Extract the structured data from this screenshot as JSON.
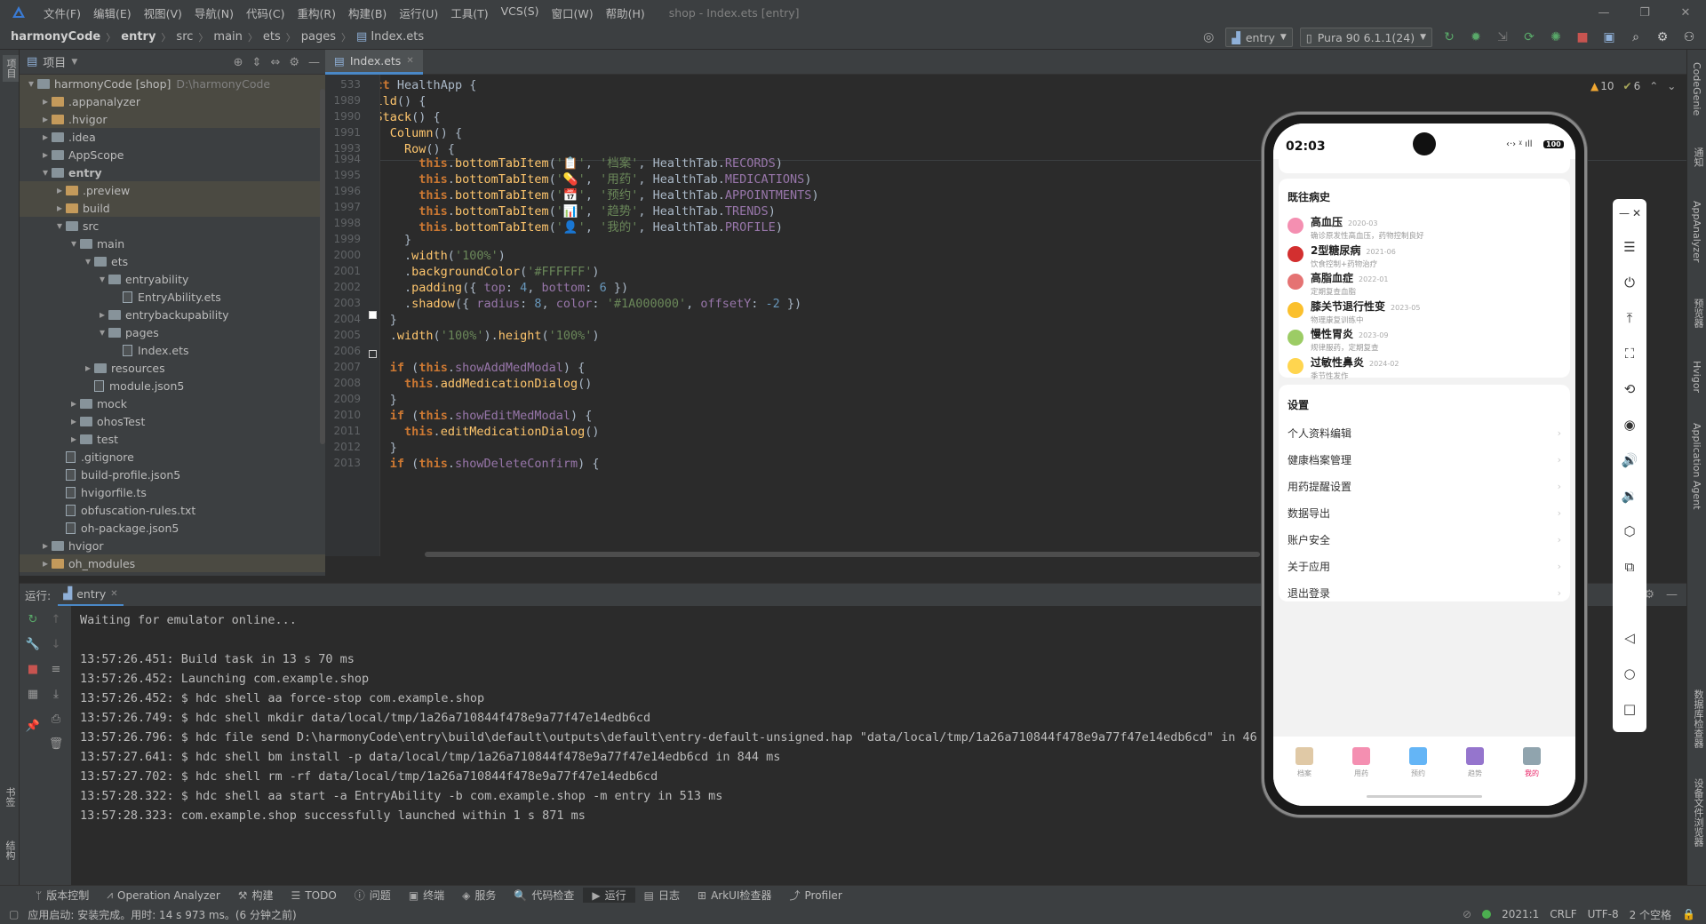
{
  "menubar": {
    "items": [
      "文件(F)",
      "编辑(E)",
      "视图(V)",
      "导航(N)",
      "代码(C)",
      "重构(R)",
      "构建(B)",
      "运行(U)",
      "工具(T)",
      "VCS(S)",
      "窗口(W)",
      "帮助(H)"
    ],
    "title": "shop - Index.ets [entry]"
  },
  "breadcrumb": [
    "harmonyCode",
    "entry",
    "src",
    "main",
    "ets",
    "pages",
    "Index.ets"
  ],
  "toolbar": {
    "run_config": "entry",
    "device": "Pura 90 6.1.1(24)"
  },
  "project_panel": {
    "title": "项目",
    "tree": [
      {
        "label": "harmonyCode [shop]",
        "path": "D:\\harmonyCode",
        "depth": 0,
        "type": "folder",
        "open": true,
        "hl": true
      },
      {
        "label": ".appanalyzer",
        "depth": 1,
        "type": "folder-orange",
        "open": false,
        "hl": true
      },
      {
        "label": ".hvigor",
        "depth": 1,
        "type": "folder-orange",
        "open": false,
        "hl": true
      },
      {
        "label": ".idea",
        "depth": 1,
        "type": "folder",
        "open": false
      },
      {
        "label": "AppScope",
        "depth": 1,
        "type": "folder",
        "open": false
      },
      {
        "label": "entry",
        "depth": 1,
        "type": "folder",
        "open": true,
        "bold": true
      },
      {
        "label": ".preview",
        "depth": 2,
        "type": "folder-orange",
        "open": false,
        "hl": true
      },
      {
        "label": "build",
        "depth": 2,
        "type": "folder-orange",
        "open": false,
        "hl": true
      },
      {
        "label": "src",
        "depth": 2,
        "type": "folder",
        "open": true
      },
      {
        "label": "main",
        "depth": 3,
        "type": "folder",
        "open": true
      },
      {
        "label": "ets",
        "depth": 4,
        "type": "folder",
        "open": true
      },
      {
        "label": "entryability",
        "depth": 5,
        "type": "folder",
        "open": true
      },
      {
        "label": "EntryAbility.ets",
        "depth": 6,
        "type": "file"
      },
      {
        "label": "entrybackupability",
        "depth": 5,
        "type": "folder",
        "open": false
      },
      {
        "label": "pages",
        "depth": 5,
        "type": "folder",
        "open": true
      },
      {
        "label": "Index.ets",
        "depth": 6,
        "type": "file"
      },
      {
        "label": "resources",
        "depth": 4,
        "type": "folder",
        "open": false
      },
      {
        "label": "module.json5",
        "depth": 4,
        "type": "file"
      },
      {
        "label": "mock",
        "depth": 3,
        "type": "folder",
        "open": false
      },
      {
        "label": "ohosTest",
        "depth": 3,
        "type": "folder",
        "open": false
      },
      {
        "label": "test",
        "depth": 3,
        "type": "folder",
        "open": false
      },
      {
        "label": ".gitignore",
        "depth": 2,
        "type": "file"
      },
      {
        "label": "build-profile.json5",
        "depth": 2,
        "type": "file"
      },
      {
        "label": "hvigorfile.ts",
        "depth": 2,
        "type": "file"
      },
      {
        "label": "obfuscation-rules.txt",
        "depth": 2,
        "type": "file"
      },
      {
        "label": "oh-package.json5",
        "depth": 2,
        "type": "file"
      },
      {
        "label": "hvigor",
        "depth": 1,
        "type": "folder",
        "open": false
      },
      {
        "label": "oh_modules",
        "depth": 1,
        "type": "folder-orange",
        "open": false,
        "hl": true
      }
    ]
  },
  "editor": {
    "tab": "Index.ets",
    "inspections": {
      "warnings": "10",
      "weak": "6"
    },
    "sticky": [
      {
        "ln": "533",
        "html": "<span class='kw'>struct</span> <span class='ty'>HealthApp</span> {"
      },
      {
        "ln": "1989",
        "html": "  <span class='fn'>build</span>() {"
      },
      {
        "ln": "1990",
        "html": "    <span class='fn'>Stack</span>() {"
      },
      {
        "ln": "1991",
        "html": "      <span class='fn'>Column</span>() {"
      },
      {
        "ln": "1993",
        "html": "        <span class='fn'>Row</span>() {"
      }
    ],
    "lines": [
      {
        "ln": "1994",
        "html": "          <span class='this'>this</span>.<span class='fn'>bottomTabItem</span>(<span class='str'>'📋'</span>, <span class='str'>'档案'</span>, HealthTab.<span class='pr'>RECORDS</span>)"
      },
      {
        "ln": "1995",
        "html": "          <span class='this'>this</span>.<span class='fn'>bottomTabItem</span>(<span class='str'>'💊'</span>, <span class='str'>'用药'</span>, HealthTab.<span class='pr'>MEDICATIONS</span>)"
      },
      {
        "ln": "1996",
        "html": "          <span class='this'>this</span>.<span class='fn'>bottomTabItem</span>(<span class='str'>'📅'</span>, <span class='str'>'预约'</span>, HealthTab.<span class='pr'>APPOINTMENTS</span>)"
      },
      {
        "ln": "1997",
        "html": "          <span class='this'>this</span>.<span class='fn'>bottomTabItem</span>(<span class='str'>'📊'</span>, <span class='str'>'趋势'</span>, HealthTab.<span class='pr'>TRENDS</span>)"
      },
      {
        "ln": "1998",
        "html": "          <span class='this'>this</span>.<span class='fn'>bottomTabItem</span>(<span class='str'>'👤'</span>, <span class='str'>'我的'</span>, HealthTab.<span class='pr'>PROFILE</span>)"
      },
      {
        "ln": "1999",
        "html": "        }"
      },
      {
        "ln": "2000",
        "html": "        .<span class='fn'>width</span>(<span class='str'>'100%'</span>)"
      },
      {
        "ln": "2001",
        "html": "        .<span class='fn'>backgroundColor</span>(<span class='str'>'#FFFFFF'</span>)"
      },
      {
        "ln": "2002",
        "html": "        .<span class='fn'>padding</span>({ <span class='pr'>top</span>: <span class='num'>4</span>, <span class='pr'>bottom</span>: <span class='num'>6</span> })"
      },
      {
        "ln": "2003",
        "html": "        .<span class='fn'>shadow</span>({ <span class='pr'>radius</span>: <span class='num'>8</span>, <span class='pr'>color</span>: <span class='str'>'#1A000000'</span>, <span class='pr'>offsetY</span>: <span class='num'>-2</span> })"
      },
      {
        "ln": "2004",
        "html": "      }"
      },
      {
        "ln": "2005",
        "html": "      .<span class='fn'>width</span>(<span class='str'>'100%'</span>).<span class='fn'>height</span>(<span class='str'>'100%'</span>)"
      },
      {
        "ln": "2006",
        "html": ""
      },
      {
        "ln": "2007",
        "html": "      <span class='kw'>if</span> (<span class='this'>this</span>.<span class='pr'>showAddMedModal</span>) {"
      },
      {
        "ln": "2008",
        "html": "        <span class='this'>this</span>.<span class='fn'>addMedicationDialog</span>()"
      },
      {
        "ln": "2009",
        "html": "      }"
      },
      {
        "ln": "2010",
        "html": "      <span class='kw'>if</span> (<span class='this'>this</span>.<span class='pr'>showEditMedModal</span>) {"
      },
      {
        "ln": "2011",
        "html": "        <span class='this'>this</span>.<span class='fn'>editMedicationDialog</span>()"
      },
      {
        "ln": "2012",
        "html": "      }"
      },
      {
        "ln": "2013",
        "html": "      <span class='kw'>if</span> (<span class='this'>this</span>.<span class='pr'>showDeleteConfirm</span>) {"
      }
    ]
  },
  "run_panel": {
    "label": "运行:",
    "tab": "entry",
    "console": [
      "Waiting for emulator online...",
      "",
      "13:57:26.451: Build task in 13 s 70 ms",
      "13:57:26.452: Launching com.example.shop",
      "13:57:26.452: $ hdc shell aa force-stop com.example.shop",
      "13:57:26.749: $ hdc shell mkdir data/local/tmp/1a26a710844f478e9a77f47e14edb6cd",
      "13:57:26.796: $ hdc file send D:\\harmonyCode\\entry\\build\\default\\outputs\\default\\entry-default-unsigned.hap \"data/local/tmp/1a26a710844f478e9a77f47e14edb6cd\" in 46 ms",
      "13:57:27.641: $ hdc shell bm install -p data/local/tmp/1a26a710844f478e9a77f47e14edb6cd in 844 ms",
      "13:57:27.702: $ hdc shell rm -rf data/local/tmp/1a26a710844f478e9a77f47e14edb6cd",
      "13:57:28.322: $ hdc shell aa start -a EntryAbility -b com.example.shop -m entry in 513 ms",
      "13:57:28.323: com.example.shop successfully launched within 1 s 871 ms"
    ]
  },
  "bottom_tools": [
    "版本控制",
    "Operation Analyzer",
    "构建",
    "TODO",
    "问题",
    "终端",
    "服务",
    "代码检查",
    "运行",
    "日志",
    "ArkUI检查器",
    "Profiler"
  ],
  "status": {
    "message": "应用启动: 安装完成。用时: 14 s 973 ms。(6 分钟之前)",
    "position": "2021:1",
    "line_sep": "CRLF",
    "encoding": "UTF-8",
    "indent": "2 个空格"
  },
  "left_strip": [
    "项目",
    "书签",
    "结构"
  ],
  "right_strip": [
    "CodeGenie",
    "通知",
    "AppAnalyzer",
    "预览器",
    "Hvigor",
    "Application Agent",
    "数据库检查器",
    "设备文件浏览器"
  ],
  "phone": {
    "time": "02:03",
    "battery": "100",
    "history_title": "既往病史",
    "history": [
      {
        "name": "高血压",
        "date": "2020-03",
        "desc": "确诊原发性高血压，药物控制良好",
        "color": "#f48fb1"
      },
      {
        "name": "2型糖尿病",
        "date": "2021-06",
        "desc": "饮食控制+药物治疗",
        "color": "#d32f2f"
      },
      {
        "name": "高脂血症",
        "date": "2022-01",
        "desc": "定期复查血脂",
        "color": "#e57373"
      },
      {
        "name": "膝关节退行性变",
        "date": "2023-05",
        "desc": "物理康复训练中",
        "color": "#fbc02d"
      },
      {
        "name": "慢性胃炎",
        "date": "2023-09",
        "desc": "规律服药，定期复查",
        "color": "#9ccc65"
      },
      {
        "name": "过敏性鼻炎",
        "date": "2024-02",
        "desc": "季节性发作",
        "color": "#ffd54f"
      }
    ],
    "settings_title": "设置",
    "settings": [
      "个人资料编辑",
      "健康档案管理",
      "用药提醒设置",
      "数据导出",
      "账户安全",
      "关于应用",
      "退出登录"
    ],
    "tabs": [
      {
        "label": "档案",
        "color": "#e0c9a6"
      },
      {
        "label": "用药",
        "color": "#f48fb1"
      },
      {
        "label": "预约",
        "color": "#64b5f6"
      },
      {
        "label": "趋势",
        "color": "#9575cd"
      },
      {
        "label": "我的",
        "color": "#90a4ae",
        "active": true
      }
    ],
    "active_tab_color": "#e91e63"
  }
}
